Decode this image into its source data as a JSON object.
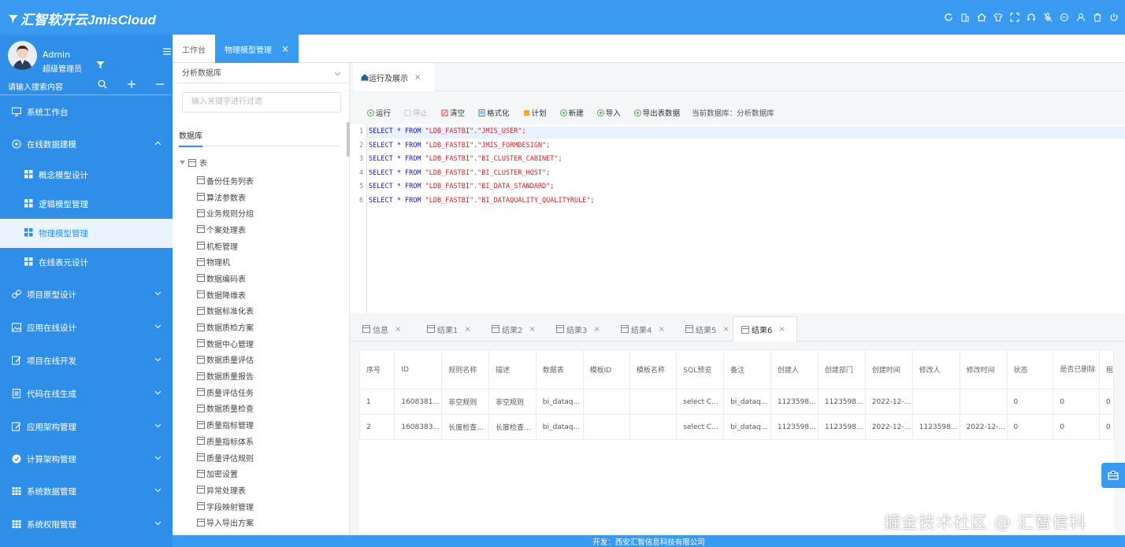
{
  "app": {
    "title": "汇智软开云JmisCloud"
  },
  "user": {
    "name": "Admin",
    "role": "超级管理员"
  },
  "search": {
    "placeholder": "请输入搜索内容"
  },
  "menu": {
    "workbench": "系统工作台",
    "online_data": "在线数据建模",
    "concept": "概念模型设计",
    "logic": "逻辑模型管理",
    "physical": "物理模型管理",
    "table_design": "在线表元设计",
    "prototype": "项目原型设计",
    "app_design": "应用在线设计",
    "project_dev": "项目在线开发",
    "codegen": "代码在线生成",
    "app_arch": "应用架构管理",
    "compute_arch": "计算架构管理",
    "sys_data": "系统数据管理",
    "sys_perm": "系统权限管理"
  },
  "tabs": {
    "workbench": "工作台",
    "current": "物理模型管理"
  },
  "db_panel": {
    "selected_db": "分析数据库",
    "filter_placeholder": "输入关键字进行过滤",
    "tab_label": "数据库",
    "root": "表",
    "tables": [
      "备份任务列表",
      "算法参数表",
      "业务规则分组",
      "个案处理表",
      "机柜管理",
      "物理机",
      "数据编码表",
      "数据降维表",
      "数据标准化表",
      "数据质检方案",
      "数据中心管理",
      "数据质量评估",
      "数据质量报告",
      "质量评估任务",
      "数据质量检查",
      "质量指标管理",
      "质量指标体系",
      "质量评估规则",
      "加密设置",
      "异常处理表",
      "字段映射管理",
      "导入导出方案"
    ]
  },
  "run_tab": {
    "label": "运行及展示"
  },
  "toolbar": {
    "run": "运行",
    "stop": "停止",
    "clear": "清空",
    "format": "格式化",
    "plan": "计划",
    "new": "新建",
    "import": "导入",
    "export": "导出表数据",
    "current_db": "当前数据库：分析数据库"
  },
  "sql": {
    "keyword": "SELECT * FROM",
    "lines": [
      {
        "no": "1",
        "table": "\"LDB_FASTBI\".\"JMIS_USER\";"
      },
      {
        "no": "2",
        "table": "\"LDB_FASTBI\".\"JMIS_FORMDESIGN\";"
      },
      {
        "no": "3",
        "table": "\"LDB_FASTBI\".\"BI_CLUSTER_CABINET\";"
      },
      {
        "no": "4",
        "table": "\"LDB_FASTBI\".\"BI_CLUSTER_HOST\";"
      },
      {
        "no": "5",
        "table": "\"LDB_FASTBI\".\"BI_DATA_STANDARD\";"
      },
      {
        "no": "6",
        "table": "\"LDB_FASTBI\".\"BI_DATAQUALITY_QUALITYRULE\";"
      }
    ]
  },
  "result_tabs": [
    "信息",
    "结果1",
    "结果2",
    "结果3",
    "结果4",
    "结果5",
    "结果6"
  ],
  "result_table": {
    "headers": [
      "序号",
      "ID",
      "规则名称",
      "描述",
      "数据表",
      "模板ID",
      "模板名称",
      "SQL预览",
      "备注",
      "创建人",
      "创建部门",
      "创建时间",
      "修改人",
      "修改时间",
      "状态",
      "是否已删除",
      "租"
    ],
    "rows": [
      [
        "1",
        "1608381...",
        "非空规则",
        "非空规则",
        "bi_dataq...",
        "",
        "",
        "select C...",
        "bi_dataq...",
        "1123598...",
        "1123598...",
        "2022-12-...",
        "",
        "",
        "0",
        "0",
        "0"
      ],
      [
        "2",
        "1608383...",
        "长度检查...",
        "长度检查...",
        "bi_dataq...",
        "",
        "",
        "select C...",
        "bi_dataq...",
        "1123598...",
        "1123598...",
        "2022-12-...",
        "1123598...",
        "2022-12-...",
        "0",
        "0",
        "0"
      ]
    ]
  },
  "footer": {
    "text": "开发：西安汇智信息科技有限公司"
  },
  "watermark": {
    "text": "掘金技术社区 @ 汇智信科"
  },
  "colors": {
    "primary": "#3a9af0",
    "sidebar": "#2f8fe8",
    "active_bg": "#e9f4ff",
    "sql_string": "#cc2222",
    "sql_keyword": "#1a1aa6"
  }
}
